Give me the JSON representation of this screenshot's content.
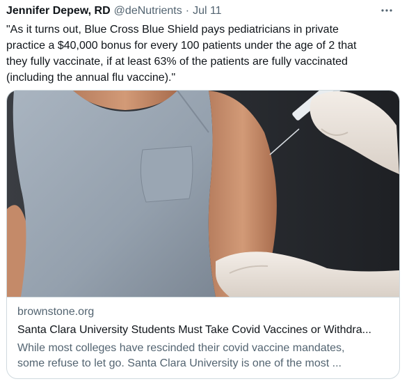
{
  "tweet": {
    "author_name": "Jennifer Depew, RD",
    "author_handle": "@deNutrients",
    "separator": "·",
    "timestamp": "Jul 11",
    "more_icon": "more-horizontal-icon",
    "text": "\"As it turns out, Blue Cross Blue Shield pays pediatricians in private\npractice a $40,000 bonus for every 100 patients under the age of 2 that\nthey fully vaccinate, if at least 63% of the patients are fully vaccinated\n(including the annual flu vaccine).\""
  },
  "card": {
    "image_alt": "Person in grey t-shirt receiving a vaccine injection in the upper arm from a gloved hand",
    "domain": "brownstone.org",
    "title": "Santa Clara University Students Must Take Covid Vaccines or Withdra...",
    "description": "While most colleges have rescinded their covid vaccine mandates,\nsome refuse to let go. Santa Clara University is one of the most ..."
  },
  "colors": {
    "text_primary": "#0f1419",
    "text_secondary": "#536471",
    "border": "#cfd9de"
  }
}
